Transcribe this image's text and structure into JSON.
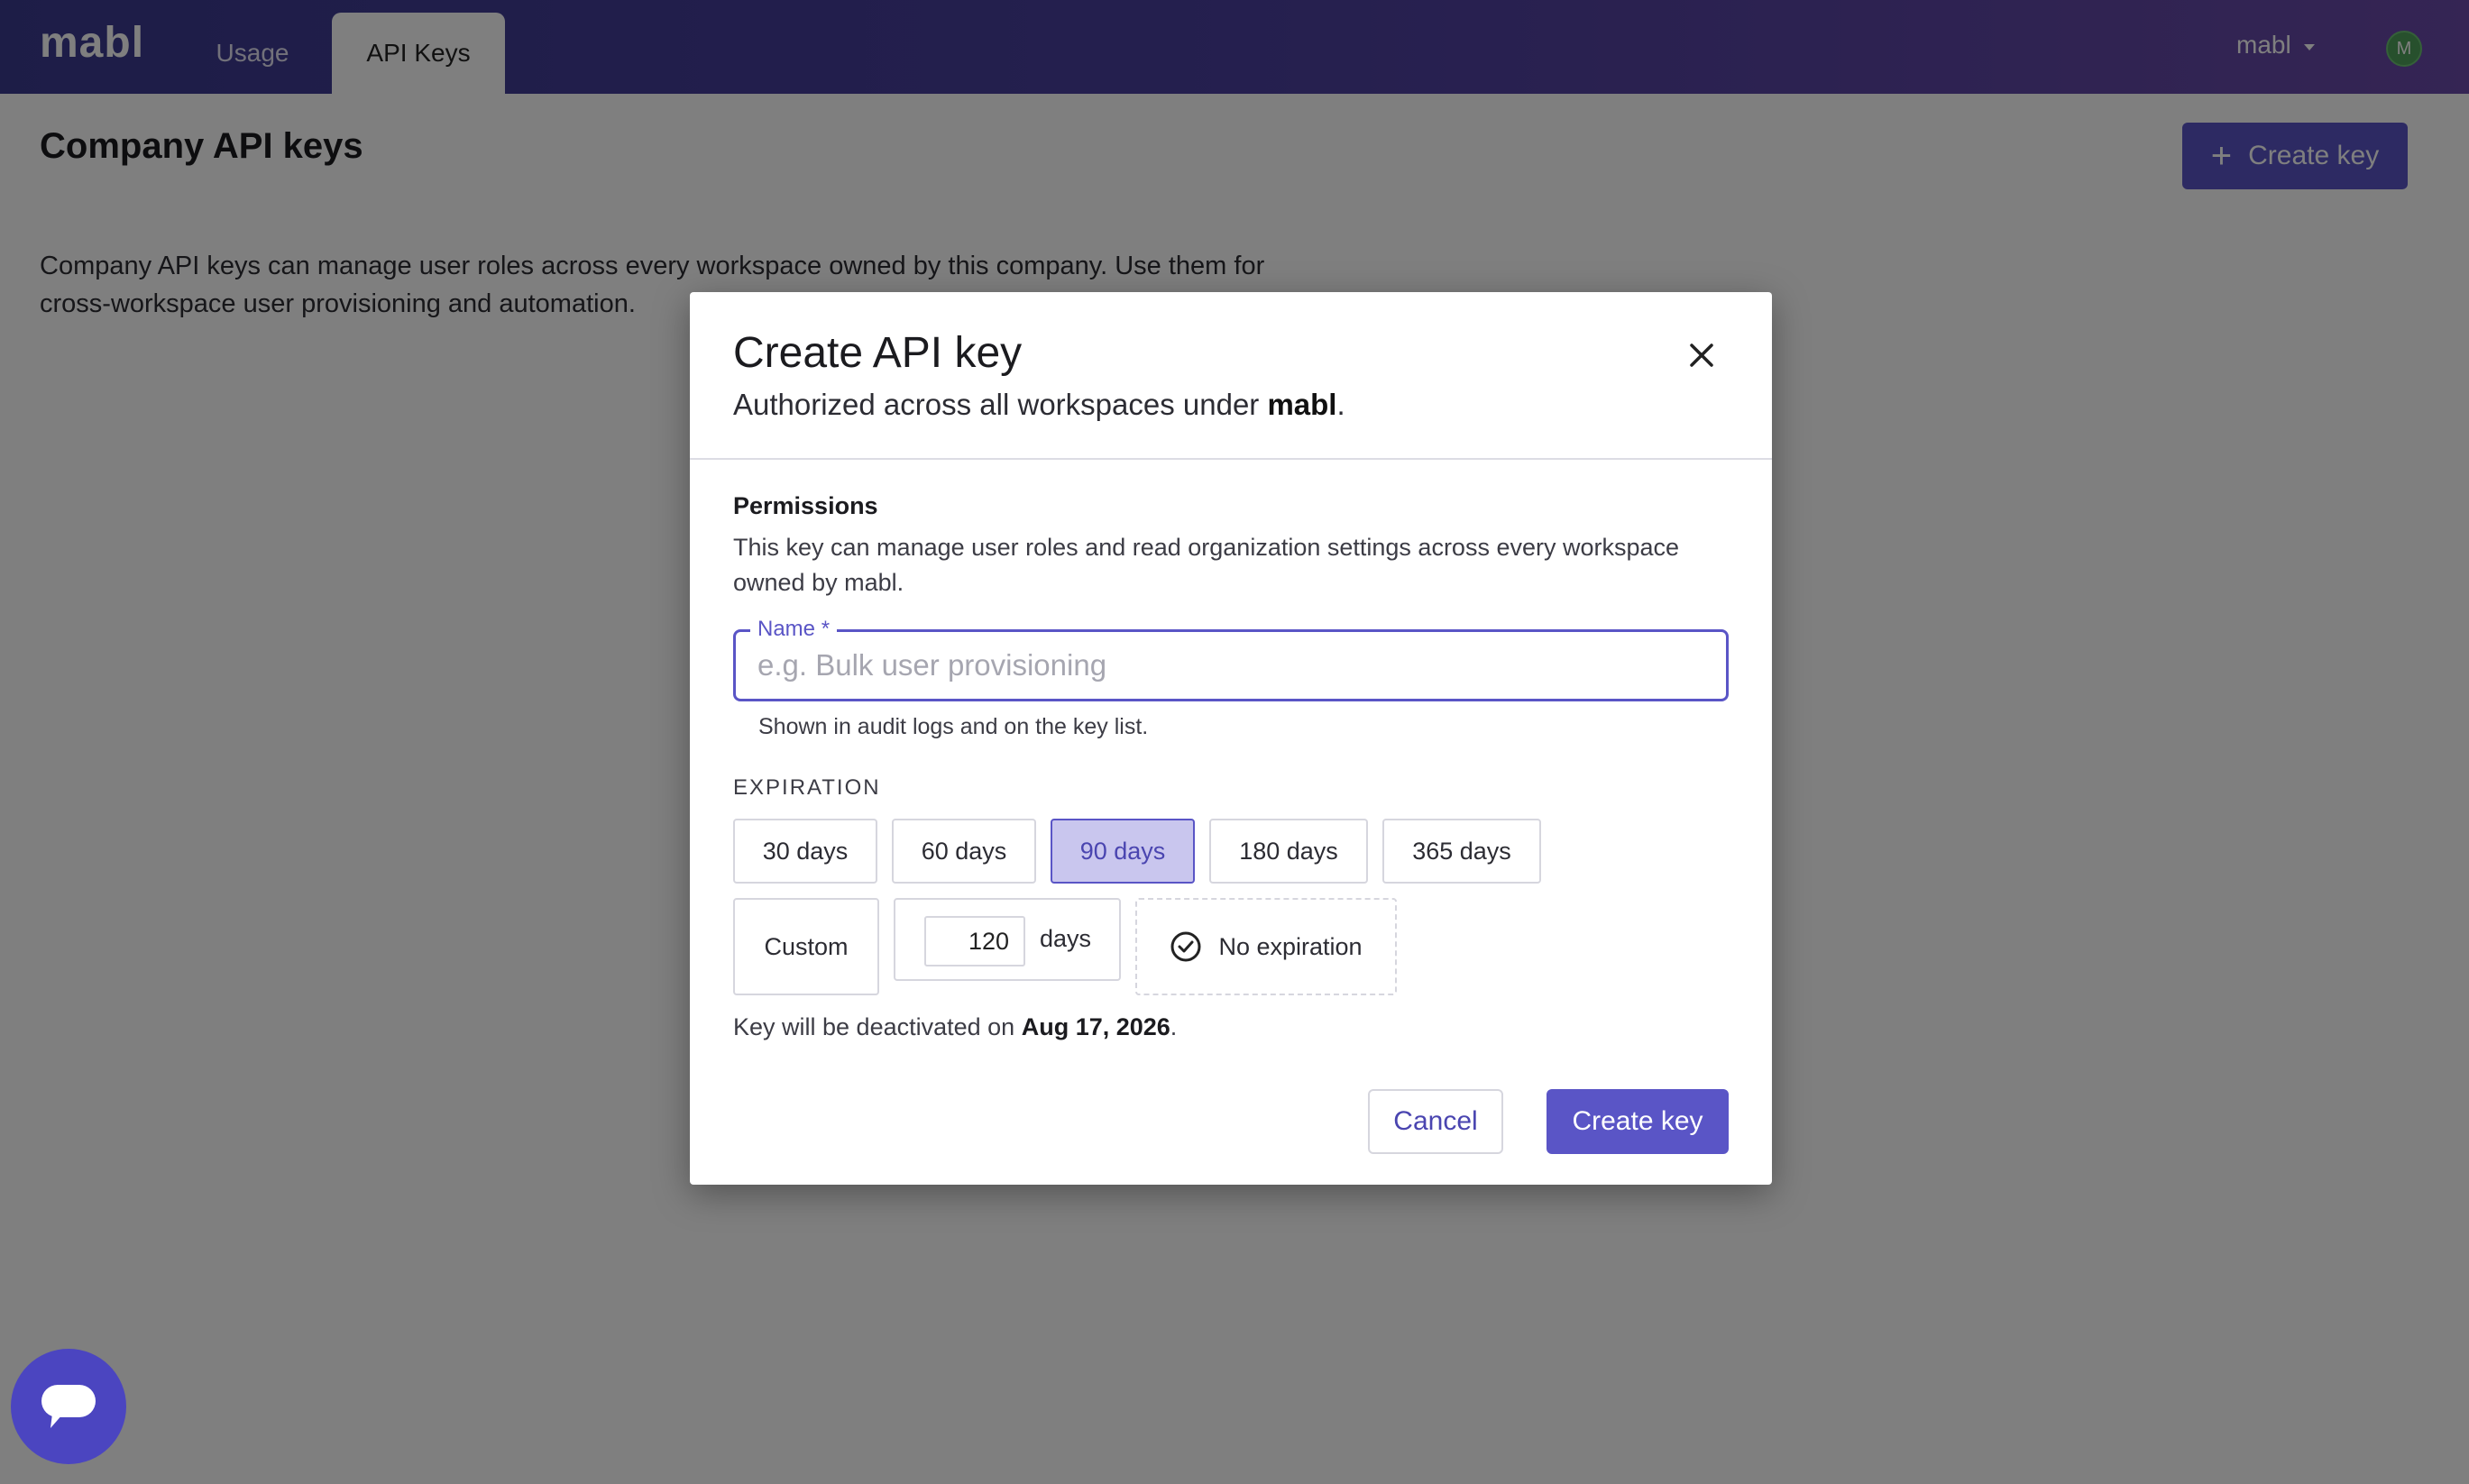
{
  "header": {
    "logo": "mabl",
    "tabs": [
      {
        "label": "Usage"
      },
      {
        "label": "API Keys",
        "active": true
      }
    ],
    "user_menu_label": "mabl",
    "avatar_initial": "M"
  },
  "page": {
    "title": "Company API keys",
    "create_button_label": "Create key",
    "description": "Company API keys can manage user roles across every workspace owned by this company. Use them for cross-workspace user provisioning and automation."
  },
  "modal": {
    "title": "Create API key",
    "subtitle_prefix": "Authorized across all workspaces under ",
    "subtitle_org": "mabl",
    "subtitle_suffix": ".",
    "permissions_label": "Permissions",
    "permissions_desc": "This key can manage user roles and read organization settings across every workspace owned by mabl.",
    "name_label": "Name",
    "name_required_mark": "*",
    "name_placeholder": "e.g. Bulk user provisioning",
    "name_value": "",
    "name_helper": "Shown in audit logs and on the key list.",
    "expiration_label": "EXPIRATION",
    "expiration_options": [
      "30 days",
      "60 days",
      "90 days",
      "180 days",
      "365 days"
    ],
    "selected_option": "90 days",
    "custom_label": "Custom",
    "custom_value": "120",
    "custom_unit": "days",
    "no_expiration_label": "No expiration",
    "deactivation_prefix": "Key will be deactivated on ",
    "deactivation_date": "Aug 17, 2026",
    "deactivation_suffix": ".",
    "cancel_label": "Cancel",
    "create_label": "Create key"
  },
  "colors": {
    "accent": "#5a55c6",
    "header_start": "#3b3a8f",
    "header_end": "#6a4aa8",
    "selected_bg": "#c9c6ee"
  }
}
